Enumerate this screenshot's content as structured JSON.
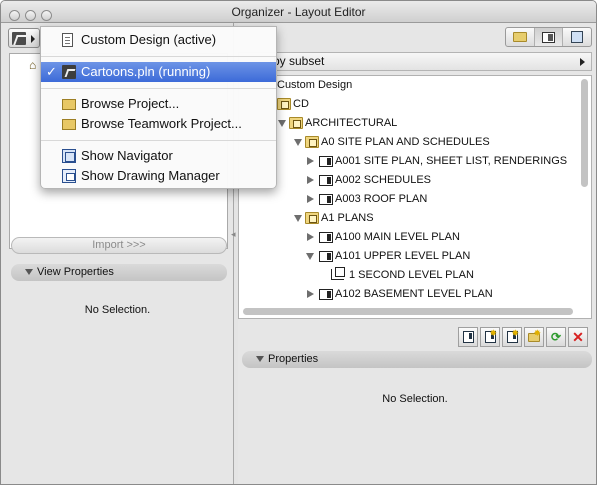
{
  "window": {
    "title": "Organizer - Layout Editor"
  },
  "left_panel": {
    "import_label": "Import >>>",
    "view_properties_label": "View Properties",
    "no_selection": "No Selection."
  },
  "right_panel": {
    "subset_label": "by subset",
    "properties_label": "Properties",
    "no_selection": "No Selection."
  },
  "menu": {
    "items": [
      {
        "label": "Custom Design (active)",
        "icon": "document-icon"
      },
      {
        "label": "Cartoons.pln (running)",
        "icon": "project-icon",
        "checked": true,
        "selected": true
      },
      {
        "label": "Browse Project...",
        "icon": "folder-open-icon"
      },
      {
        "label": "Browse Teamwork Project...",
        "icon": "folder-open-icon"
      },
      {
        "label": "Show Navigator",
        "icon": "navigator-icon"
      },
      {
        "label": "Show Drawing Manager",
        "icon": "drawing-manager-icon"
      }
    ]
  },
  "tree": {
    "root": "Custom Design",
    "rows": [
      {
        "label": "CD",
        "type": "folder",
        "level": 0,
        "expand": "none"
      },
      {
        "label": "ARCHITECTURAL",
        "type": "folder",
        "level": 1,
        "expand": "open"
      },
      {
        "label": "A0 SITE PLAN AND SCHEDULES",
        "type": "folder",
        "level": 2,
        "expand": "open"
      },
      {
        "label": "A001 SITE PLAN, SHEET LIST, RENDERINGS",
        "type": "sheet",
        "level": 3,
        "expand": "closed"
      },
      {
        "label": "A002 SCHEDULES",
        "type": "sheet",
        "level": 3,
        "expand": "closed"
      },
      {
        "label": "A003 ROOF PLAN",
        "type": "sheet",
        "level": 3,
        "expand": "closed"
      },
      {
        "label": "A1 PLANS",
        "type": "folder",
        "level": 2,
        "expand": "open"
      },
      {
        "label": "A100 MAIN LEVEL PLAN",
        "type": "sheet",
        "level": 3,
        "expand": "closed"
      },
      {
        "label": "A101 UPPER LEVEL PLAN",
        "type": "sheet",
        "level": 3,
        "expand": "open"
      },
      {
        "label": "1 SECOND LEVEL PLAN",
        "type": "view",
        "level": 4,
        "expand": "none"
      },
      {
        "label": "A102 BASEMENT LEVEL PLAN",
        "type": "sheet",
        "level": 3,
        "expand": "closed"
      }
    ]
  },
  "colors": {
    "menu_selection": "#3c6ad8",
    "folder": "#efd57e",
    "delete": "#d82020",
    "add": "#2e9b2e"
  }
}
